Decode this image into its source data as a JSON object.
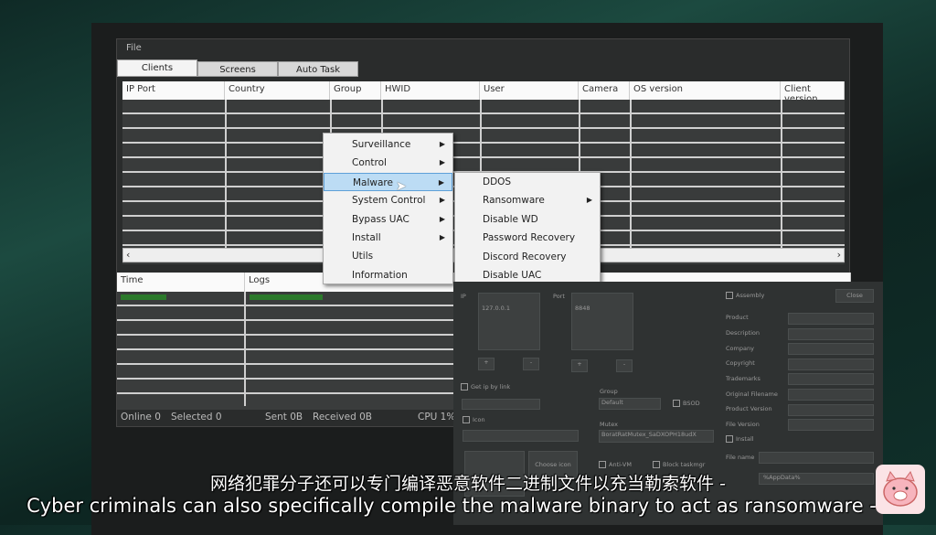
{
  "app": {
    "menu_file": "File",
    "tabs": [
      "Clients",
      "Screens",
      "Auto Task"
    ],
    "columns": [
      "IP Port",
      "Country",
      "Group",
      "HWID",
      "User",
      "Camera",
      "OS version",
      "Client version"
    ],
    "log_columns": [
      "Time",
      "Logs"
    ],
    "status": {
      "online": "Online 0",
      "selected": "Selected 0",
      "sent": "Sent 0B",
      "received": "Received  0B",
      "cpu": "CPU 1%"
    }
  },
  "context_menu": {
    "items": [
      {
        "label": "Surveillance",
        "sub": true
      },
      {
        "label": "Control",
        "sub": true
      },
      {
        "label": "Malware",
        "sub": true,
        "highlighted": true
      },
      {
        "label": "System Control",
        "sub": true
      },
      {
        "label": "Bypass UAC",
        "sub": true
      },
      {
        "label": "Install",
        "sub": true
      },
      {
        "label": "Utils",
        "sub": false
      },
      {
        "label": "Information",
        "sub": false
      }
    ]
  },
  "submenu": {
    "items": [
      {
        "label": "DDOS",
        "sub": false
      },
      {
        "label": "Ransomware",
        "sub": true
      },
      {
        "label": "Disable WD",
        "sub": false
      },
      {
        "label": "Password Recovery",
        "sub": false
      },
      {
        "label": "Discord Recovery",
        "sub": false
      },
      {
        "label": "Disable UAC",
        "sub": false
      }
    ]
  },
  "builder": {
    "ip_label": "IP",
    "ip_value": "127.0.0.1",
    "port_label": "Port",
    "port_value": "8848",
    "plus": "+",
    "minus": "-",
    "get_ip_by_link": "Get ip by link",
    "icon": "Icon",
    "choose_icon": "Choose icon",
    "group_label": "Group",
    "group_value": "Default",
    "bsod": "BSOD",
    "mutex_label": "Mutex",
    "mutex_value": "BoratRatMutex_SaDXOPH18udX",
    "anti_vm": "Anti-VM",
    "block_taskmgr": "Block taskmgr",
    "assembly": "Assembly",
    "close": "Close",
    "fields": [
      "Product",
      "Description",
      "Company",
      "Copyright",
      "Trademarks",
      "Original Filename",
      "Product Version",
      "File Version"
    ],
    "install": "Install",
    "file_name": "File name",
    "path_value": "%AppData%"
  },
  "subtitles": {
    "zh": "网络犯罪分子还可以专门编译恶意软件二进制文件以充当勒索软件 -",
    "en": "Cyber criminals can also specifically compile the malware binary to act as ransomware - TO"
  }
}
